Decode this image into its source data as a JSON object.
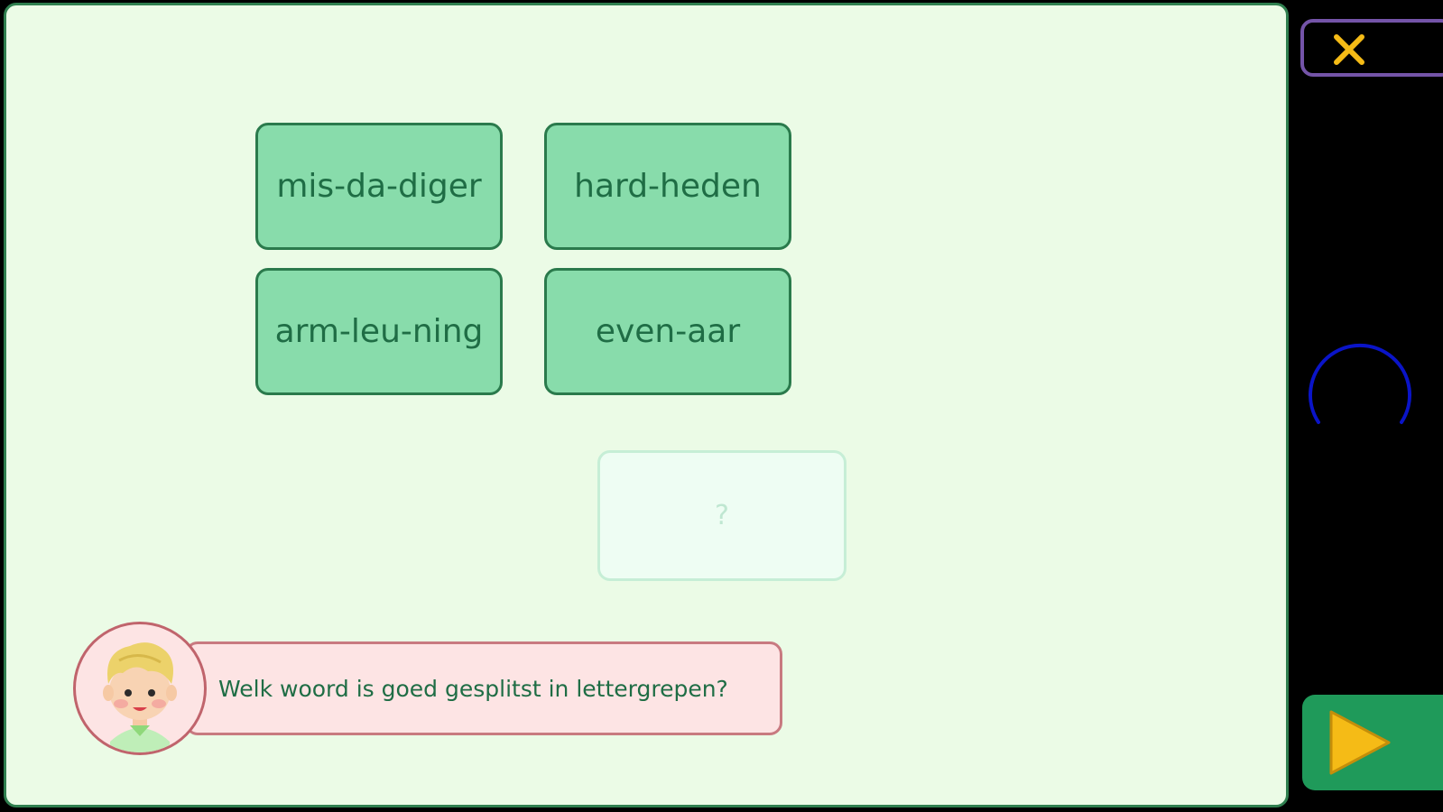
{
  "instruction": "Welk woord is goed gesplitst in lettergrepen?",
  "words": [
    "mis-da-diger",
    "hard-heden",
    "arm-leu-ning",
    "even-aar"
  ],
  "answer_slot": {
    "placeholder": "?"
  },
  "icons": {
    "close": "close-icon",
    "next": "play-icon",
    "loading": "loading-spinner-icon",
    "avatar": "boy-avatar"
  },
  "colors": {
    "board_background": "#ebfbe6",
    "card_fill": "#88dcab",
    "card_text": "#1f6d45",
    "bubble_fill": "#fde4e4",
    "close_icon": "#f5bb16",
    "next_button": "#1f9a5a",
    "next_icon": "#f5bb16",
    "spinner": "#0a14c8"
  }
}
